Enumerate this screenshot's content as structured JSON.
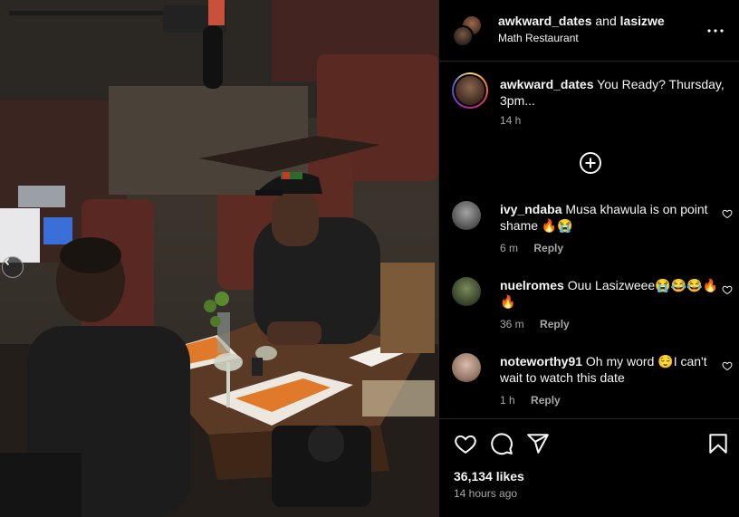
{
  "post": {
    "header": {
      "user1": "awkward_dates",
      "and": "and",
      "user2": "lasizwe",
      "location": "Math Restaurant"
    },
    "caption": {
      "username": "awkward_dates",
      "text": "You Ready? Thursday, 3pm...",
      "time": "14 h"
    },
    "comments": [
      {
        "username": "ivy_ndaba",
        "text": "Musa khawula is on point shame 🔥😭",
        "time": "6 m",
        "reply": "Reply",
        "avatar_color": "#8a8a8a"
      },
      {
        "username": "nuelromes",
        "text": "Ouu Lasizweee😭😂😂🔥🔥",
        "time": "36 m",
        "reply": "Reply",
        "avatar_color": "#5e6e4a"
      },
      {
        "username": "noteworthy91",
        "text": "Oh my word 😌I can't wait to watch this date",
        "time": "1 h",
        "reply": "Reply",
        "avatar_color": "#b59a8a"
      }
    ],
    "likes": "36,134 likes",
    "posted": "14 hours ago"
  },
  "icons": {
    "more": "more-horizontal-icon",
    "load_more": "plus-circle-icon",
    "like": "heart-icon",
    "comment": "comment-icon",
    "share": "share-icon",
    "save": "bookmark-icon",
    "prev": "chevron-left-icon"
  },
  "colors": {
    "background": "#000000",
    "secondary_text": "#a8a8a8",
    "divider": "#262626"
  }
}
